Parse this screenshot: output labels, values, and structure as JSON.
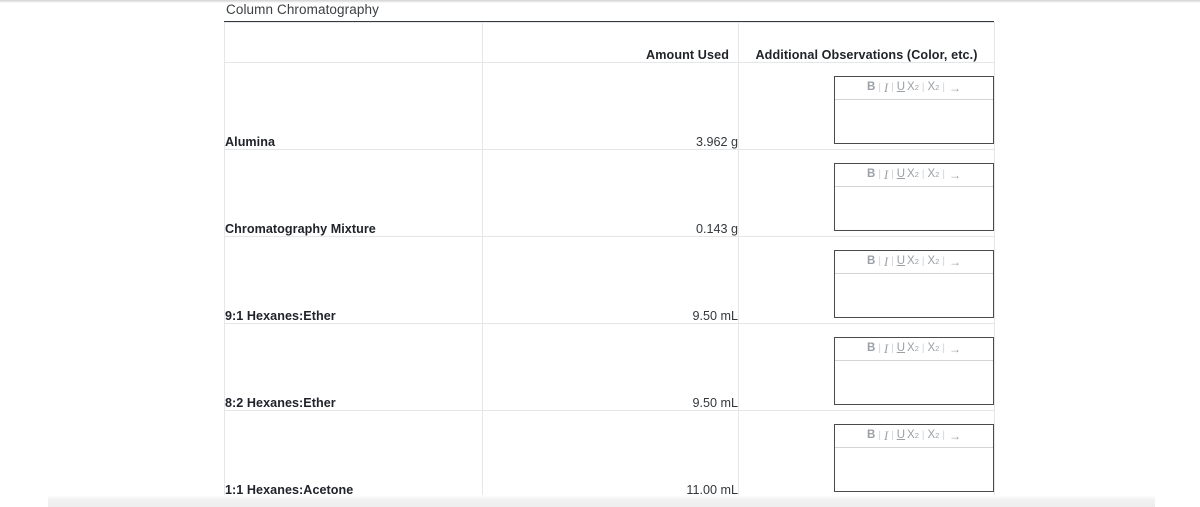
{
  "section": {
    "title": "Column Chromatography"
  },
  "table": {
    "headers": {
      "label": "",
      "amount": "Amount Used",
      "observations": "Additional Observations (Color, etc.)"
    },
    "rows": [
      {
        "label": "Alumina",
        "amount": "3.962 g"
      },
      {
        "label": "Chromatography Mixture",
        "amount": "0.143 g"
      },
      {
        "label": "9:1 Hexanes:Ether",
        "amount": "9.50 mL"
      },
      {
        "label": "8:2 Hexanes:Ether",
        "amount": "9.50 mL"
      },
      {
        "label": "1:1 Hexanes:Acetone",
        "amount": "11.00 mL"
      }
    ]
  },
  "editor": {
    "bold_label": "B",
    "italic_label": "I",
    "underline_label": "U",
    "subscript_base": "X",
    "subscript_small": "2",
    "superscript_base": "X",
    "superscript_small": "2",
    "arrow_label": "→",
    "separator": "|",
    "text": ""
  },
  "colors": {
    "grid_line": "#e4e6e8",
    "top_rule": "#35393d",
    "editor_border": "#4a4a4a",
    "toolbar_icon": "#9aa0a6",
    "text_primary": "#20242a",
    "title_text": "#3c4043"
  }
}
